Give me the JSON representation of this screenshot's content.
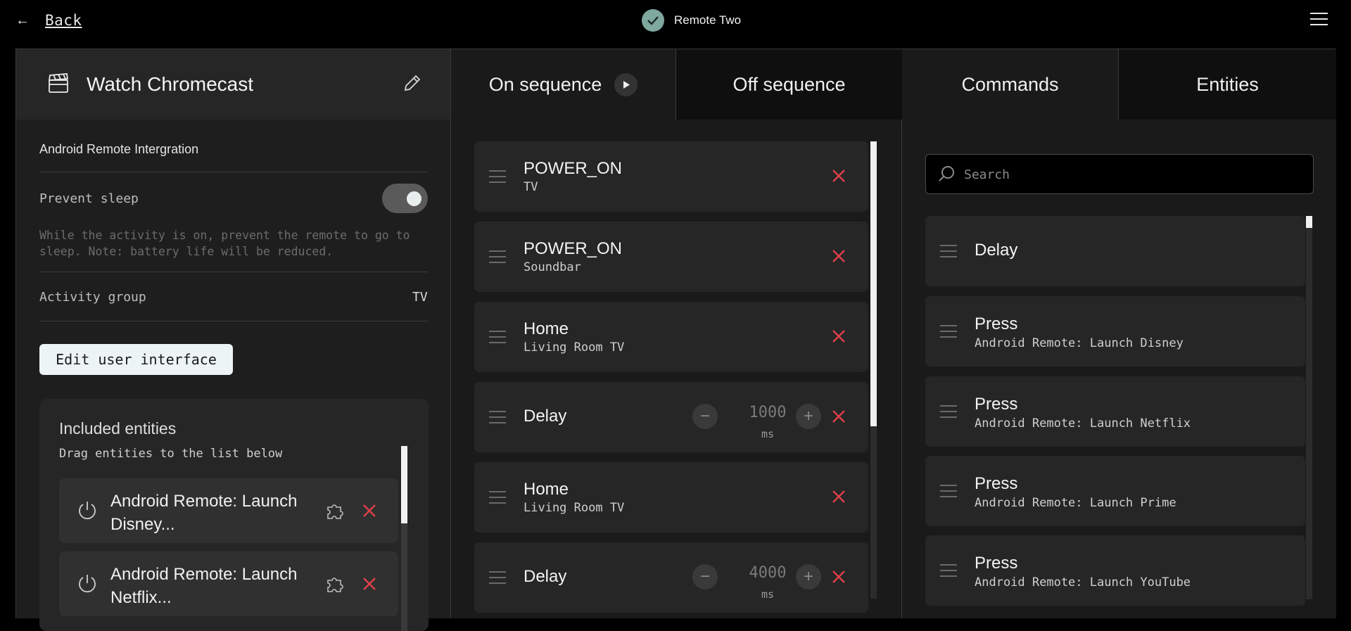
{
  "topbar": {
    "back_label": "Back",
    "device_name": "Remote Two"
  },
  "activity": {
    "title": "Watch Chromecast",
    "integration": "Android Remote Intergration",
    "prevent_sleep_label": "Prevent sleep",
    "prevent_sleep_on": true,
    "prevent_sleep_desc": "While the activity is on, prevent the remote to go to sleep. Note: battery life will be reduced.",
    "activity_group_label": "Activity group",
    "activity_group_value": "TV",
    "edit_ui_label": "Edit user interface"
  },
  "included": {
    "title": "Included entities",
    "hint": "Drag entities to the list below",
    "items": [
      {
        "label": "Android Remote: Launch Disney..."
      },
      {
        "label": "Android Remote: Launch Netflix..."
      }
    ]
  },
  "tabs": [
    {
      "label": "On sequence",
      "active": true
    },
    {
      "label": "Off sequence",
      "active": false
    },
    {
      "label": "Commands",
      "active": true
    },
    {
      "label": "Entities",
      "active": false
    }
  ],
  "sequence": [
    {
      "cmd": "POWER_ON",
      "target": "TV"
    },
    {
      "cmd": "POWER_ON",
      "target": "Soundbar"
    },
    {
      "cmd": "Home",
      "target": "Living Room TV"
    },
    {
      "cmd": "Delay",
      "value": "1000",
      "unit": "ms"
    },
    {
      "cmd": "Home",
      "target": "Living Room TV"
    },
    {
      "cmd": "Delay",
      "value": "4000",
      "unit": "ms"
    }
  ],
  "commands": {
    "search_placeholder": "Search",
    "items": [
      {
        "cmd": "Delay",
        "target": ""
      },
      {
        "cmd": "Press",
        "target": "Android Remote: Launch Disney"
      },
      {
        "cmd": "Press",
        "target": "Android Remote: Launch Netflix"
      },
      {
        "cmd": "Press",
        "target": "Android Remote: Launch Prime"
      },
      {
        "cmd": "Press",
        "target": "Android Remote: Launch YouTube"
      }
    ]
  },
  "colors": {
    "accent_check": "#7fa89e",
    "delete_red": "#e0404a"
  }
}
